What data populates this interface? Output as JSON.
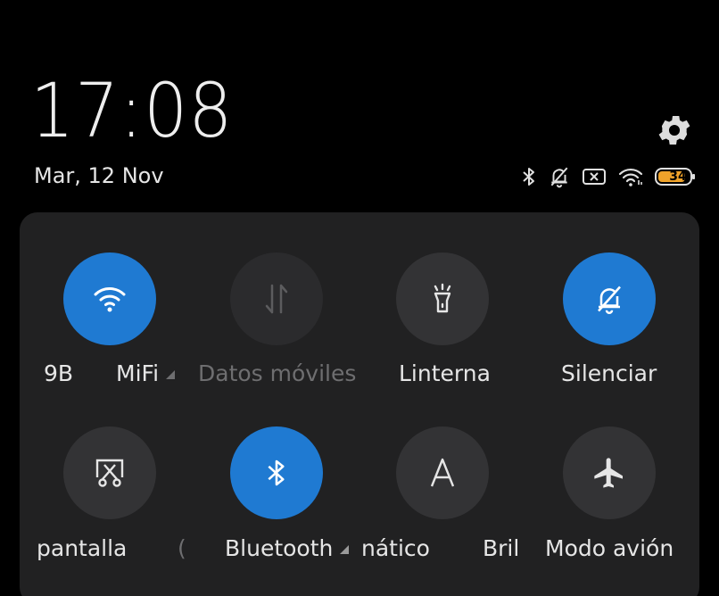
{
  "status": {
    "time": "17:08",
    "date": "Mar, 12 Nov",
    "battery": "34"
  },
  "colors": {
    "accent": "#1f7ad2",
    "tile_off": "#333335",
    "panel": "#212122",
    "battery_fill": "#f0a32a"
  },
  "tiles": [
    {
      "icon": "wifi-icon",
      "active": true
    },
    {
      "icon": "mobile-data-arrows-icon",
      "active": false,
      "disabled": true
    },
    {
      "icon": "flashlight-icon",
      "active": false
    },
    {
      "icon": "bell-slash-icon",
      "active": true
    },
    {
      "icon": "screenshot-scissors-icon",
      "active": false
    },
    {
      "icon": "bluetooth-icon",
      "active": true
    },
    {
      "icon": "font-a-icon",
      "active": false
    },
    {
      "icon": "airplane-icon",
      "active": false
    }
  ],
  "labels": {
    "row1": {
      "wifi_tail": "9B",
      "wifi_next": "MiFi",
      "datos": "Datos móviles",
      "linterna": "Linterna",
      "silenciar": "Silenciar"
    },
    "row2": {
      "pantalla": "pantalla",
      "fragment": "(",
      "bluetooth": "Bluetooth",
      "automatico": "nático",
      "brillo": "Bril",
      "modo_avion": "Modo avión"
    }
  }
}
